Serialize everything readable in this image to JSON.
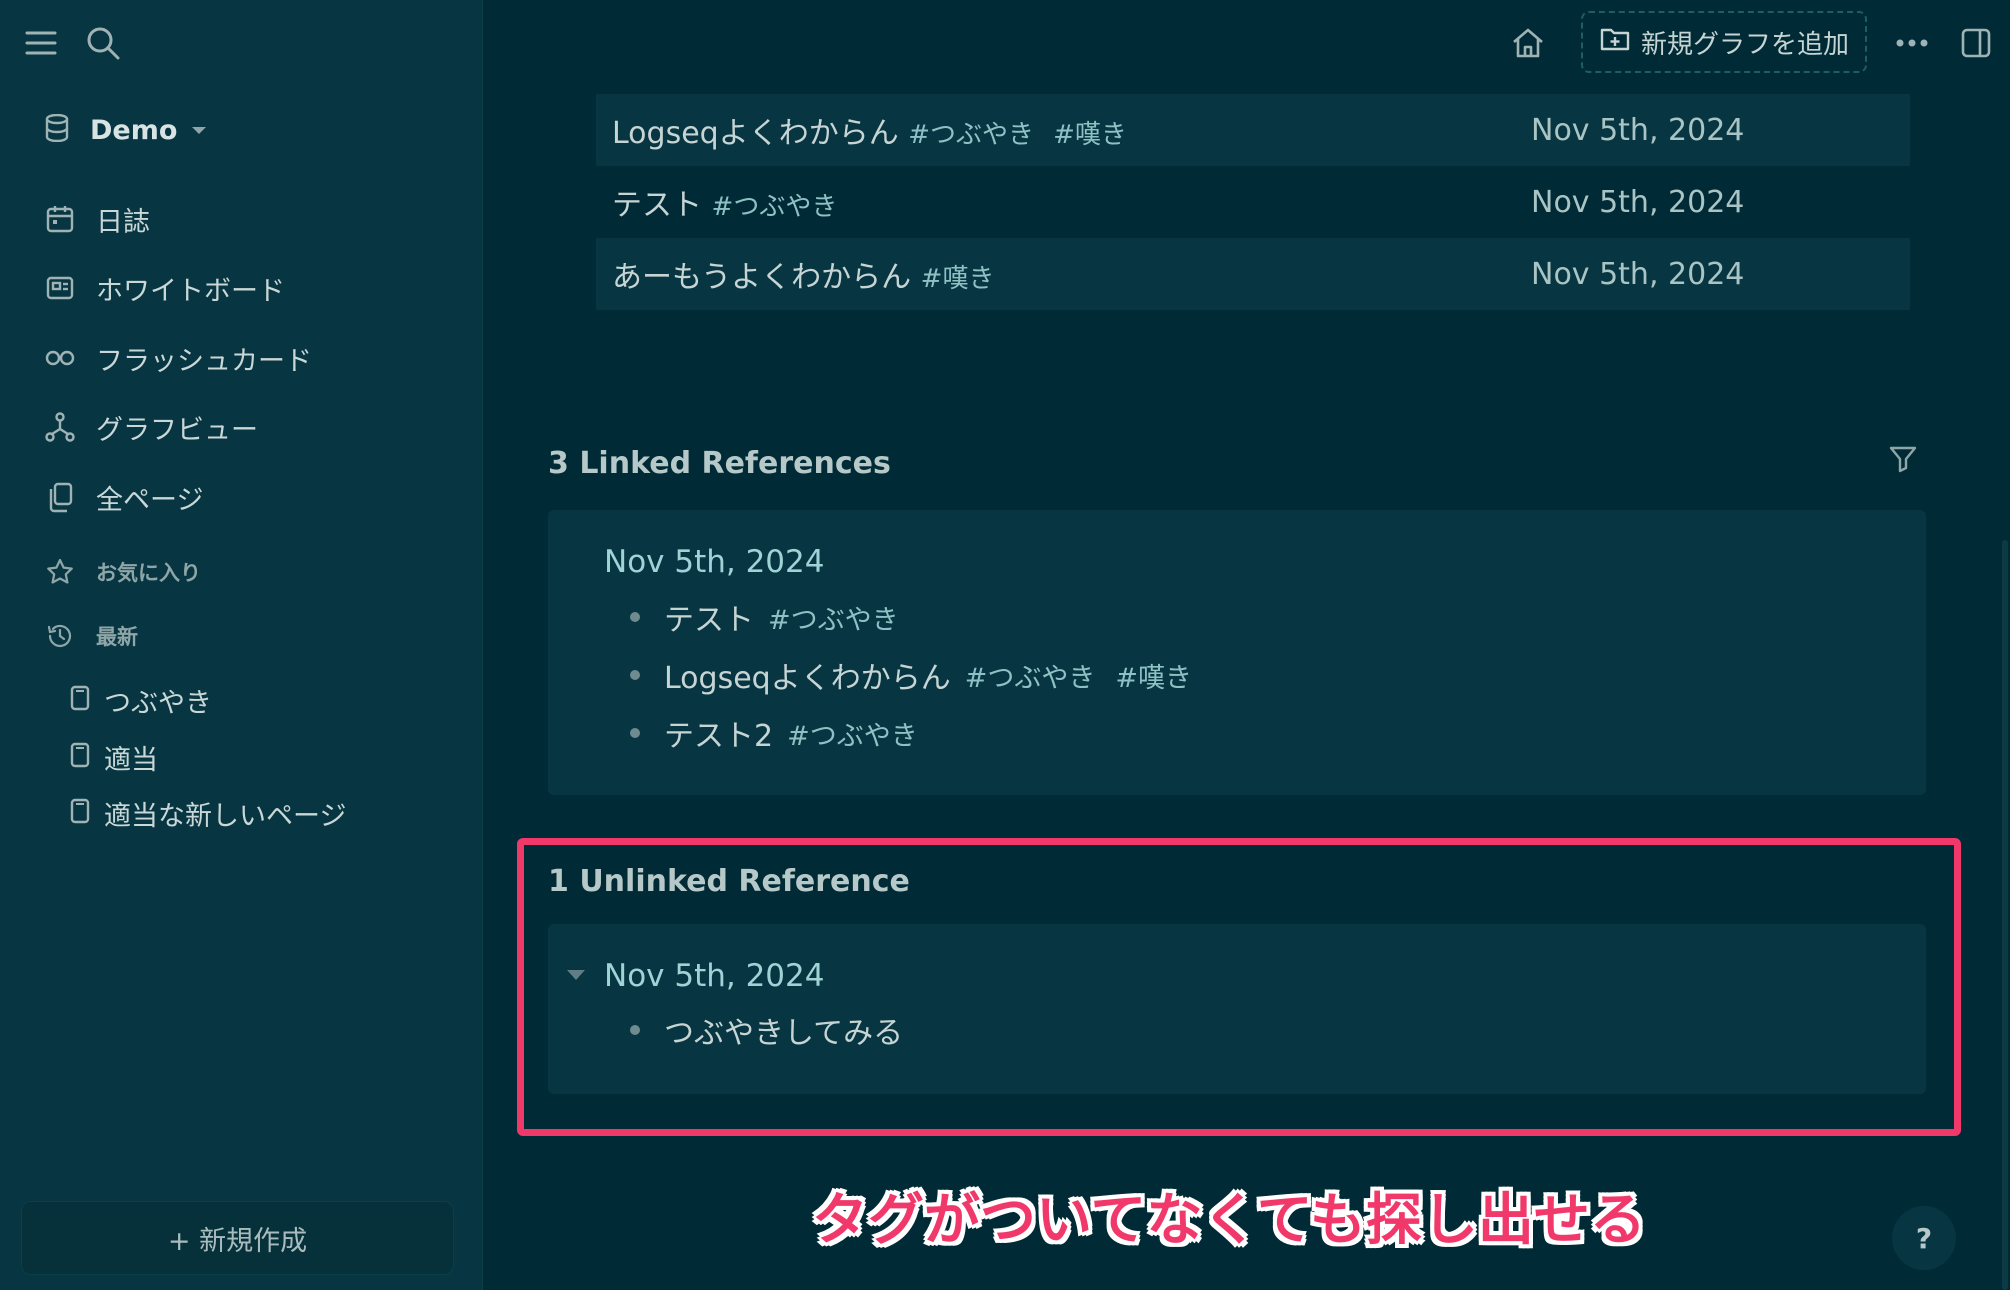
{
  "sidebar": {
    "graph_name": "Demo",
    "nav": [
      {
        "label": "日誌",
        "icon": "calendar-icon"
      },
      {
        "label": "ホワイトボード",
        "icon": "whiteboard-icon"
      },
      {
        "label": "フラッシュカード",
        "icon": "infinity-icon"
      },
      {
        "label": "グラフビュー",
        "icon": "graph-icon"
      },
      {
        "label": "全ページ",
        "icon": "pages-icon"
      }
    ],
    "favorites_label": "お気に入り",
    "recent_label": "最新",
    "recent_items": [
      "つぶやき",
      "適当",
      "適当な新しいページ"
    ],
    "new_button": "+ 新規作成"
  },
  "header": {
    "add_graph_label": "新規グラフを追加"
  },
  "query_table": {
    "rows": [
      {
        "title": "Logseqよくわからん",
        "tags": [
          "#つぶやき",
          "#嘆き"
        ],
        "date": "Nov 5th, 2024"
      },
      {
        "title": "テスト",
        "tags": [
          "#つぶやき"
        ],
        "date": "Nov 5th, 2024"
      },
      {
        "title": "あーもうよくわからん",
        "tags": [
          "#嘆き"
        ],
        "date": "Nov 5th, 2024"
      }
    ]
  },
  "linked_refs": {
    "heading": "3 Linked References",
    "date": "Nov 5th, 2024",
    "blocks": [
      {
        "text": "テスト",
        "tags": [
          "#つぶやき"
        ]
      },
      {
        "text": "Logseqよくわからん",
        "tags": [
          "#つぶやき",
          "#嘆き"
        ]
      },
      {
        "text": "テスト2",
        "tags": [
          "#つぶやき"
        ]
      }
    ]
  },
  "unlinked_refs": {
    "heading": "1 Unlinked Reference",
    "date": "Nov 5th, 2024",
    "blocks": [
      {
        "text": "つぶやきしてみる"
      }
    ]
  },
  "annotation": "タグがついてなくても探し出せる",
  "help_label": "?",
  "colors": {
    "background": "#002b36",
    "sidebar": "#073642",
    "highlight": "#f0386b",
    "link": "#9fd3d6"
  }
}
